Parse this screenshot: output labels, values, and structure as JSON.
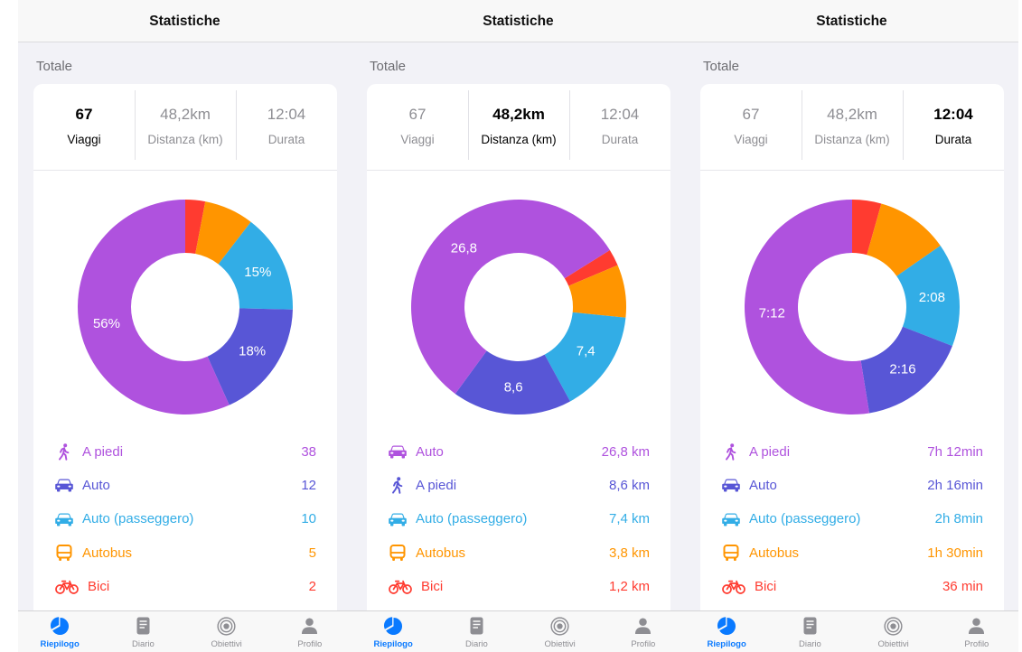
{
  "theme": {
    "accent": "#0A7AFF",
    "muted": "#8E8E93",
    "background": "#F2F2F7",
    "card": "#FFFFFF"
  },
  "panels": [
    {
      "title": "Statistiche",
      "section_label": "Totale",
      "summary": [
        {
          "value": "67",
          "label": "Viaggi",
          "selected": true
        },
        {
          "value": "48,2km",
          "label": "Distanza (km)",
          "selected": false
        },
        {
          "value": "12:04",
          "label": "Durata",
          "selected": false
        }
      ],
      "tabs": [
        {
          "icon": "pie-chart-icon",
          "label": "Riepilogo",
          "active": true
        },
        {
          "icon": "document-icon",
          "label": "Diario",
          "active": false
        },
        {
          "icon": "target-icon",
          "label": "Obiettivi",
          "active": false
        },
        {
          "icon": "person-icon",
          "label": "Profilo",
          "active": false
        }
      ]
    },
    {
      "title": "Statistiche",
      "section_label": "Totale",
      "summary": [
        {
          "value": "67",
          "label": "Viaggi",
          "selected": false
        },
        {
          "value": "48,2km",
          "label": "Distanza (km)",
          "selected": true
        },
        {
          "value": "12:04",
          "label": "Durata",
          "selected": false
        }
      ],
      "tabs": [
        {
          "icon": "pie-chart-icon",
          "label": "Riepilogo",
          "active": true
        },
        {
          "icon": "document-icon",
          "label": "Diario",
          "active": false
        },
        {
          "icon": "target-icon",
          "label": "Obiettivi",
          "active": false
        },
        {
          "icon": "person-icon",
          "label": "Profilo",
          "active": false
        }
      ]
    },
    {
      "title": "Statistiche",
      "section_label": "Totale",
      "summary": [
        {
          "value": "67",
          "label": "Viaggi",
          "selected": false
        },
        {
          "value": "48,2km",
          "label": "Distanza (km)",
          "selected": false
        },
        {
          "value": "12:04",
          "label": "Durata",
          "selected": true
        }
      ],
      "tabs": [
        {
          "icon": "pie-chart-icon",
          "label": "Riepilogo",
          "active": true
        },
        {
          "icon": "document-icon",
          "label": "Diario",
          "active": false
        },
        {
          "icon": "target-icon",
          "label": "Obiettivi",
          "active": false
        },
        {
          "icon": "person-icon",
          "label": "Profilo",
          "active": false
        }
      ]
    }
  ],
  "chart_data": [
    {
      "type": "pie",
      "donut": true,
      "categories": [
        "A piedi",
        "Auto",
        "Auto (passeggero)",
        "Autobus",
        "Bici"
      ],
      "values": [
        38,
        12,
        10,
        5,
        2
      ],
      "value_labels": [
        "38",
        "12",
        "10",
        "5",
        "2"
      ],
      "slice_labels": [
        "56%",
        "18%",
        "15%",
        "",
        ""
      ],
      "colors": [
        "#AF52DE",
        "#5856D6",
        "#32ADE6",
        "#FF9500",
        "#FF3B30"
      ],
      "icons": [
        "walking-icon",
        "car-icon",
        "car-icon",
        "bus-icon",
        "bicycle-icon"
      ]
    },
    {
      "type": "pie",
      "donut": true,
      "categories": [
        "Auto",
        "A piedi",
        "Auto (passeggero)",
        "Autobus",
        "Bici"
      ],
      "values": [
        26.8,
        8.6,
        7.4,
        3.8,
        1.2
      ],
      "value_labels": [
        "26,8 km",
        "8,6 km",
        "7,4 km",
        "3,8 km",
        "1,2 km"
      ],
      "slice_labels": [
        "26,8",
        "8,6",
        "7,4",
        "",
        ""
      ],
      "colors": [
        "#AF52DE",
        "#5856D6",
        "#32ADE6",
        "#FF9500",
        "#FF3B30"
      ],
      "icons": [
        "car-icon",
        "walking-icon",
        "car-icon",
        "bus-icon",
        "bicycle-icon"
      ]
    },
    {
      "type": "pie",
      "donut": true,
      "categories": [
        "A piedi",
        "Auto",
        "Auto (passeggero)",
        "Autobus",
        "Bici"
      ],
      "values": [
        432,
        136,
        128,
        90,
        36
      ],
      "value_labels": [
        "7h 12min",
        "2h 16min",
        "2h 8min",
        "1h 30min",
        "36 min"
      ],
      "slice_labels": [
        "7:12",
        "2:16",
        "2:08",
        "",
        ""
      ],
      "colors": [
        "#AF52DE",
        "#5856D6",
        "#32ADE6",
        "#FF9500",
        "#FF3B30"
      ],
      "icons": [
        "walking-icon",
        "car-icon",
        "car-icon",
        "bus-icon",
        "bicycle-icon"
      ]
    }
  ]
}
